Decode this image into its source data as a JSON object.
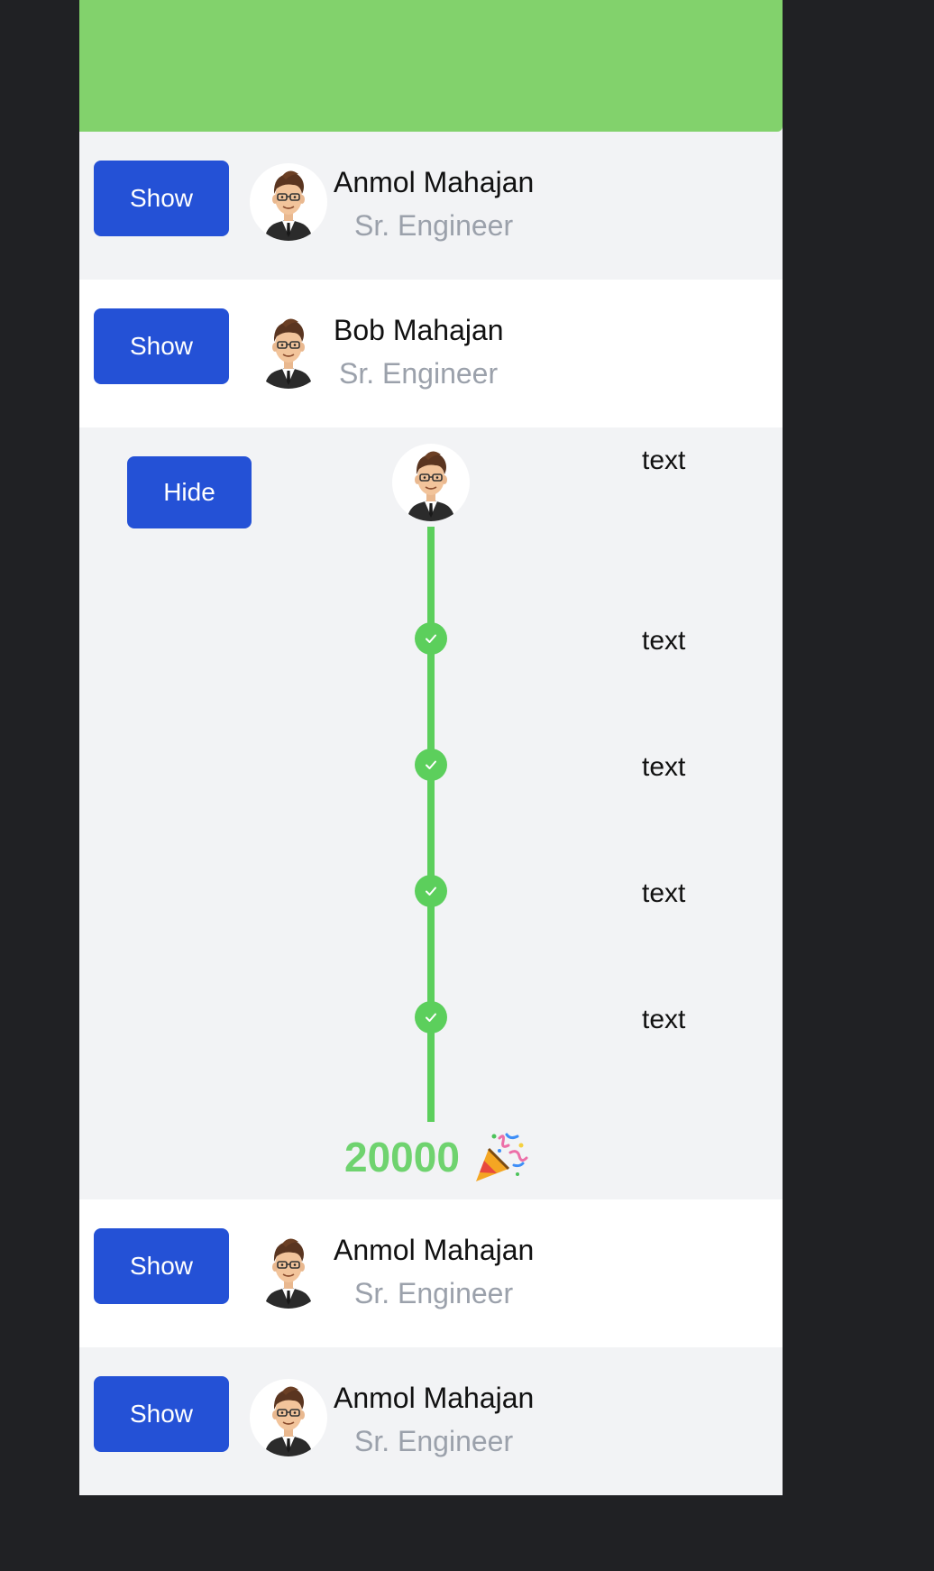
{
  "header": {
    "color": "#82d26c"
  },
  "accent": "#2451d6",
  "timeline_color": "#5ccf5c",
  "rows_top": [
    {
      "button": "Show",
      "name": "Anmol Mahajan",
      "role": "Sr. Engineer"
    },
    {
      "button": "Show",
      "name": "Bob Mahajan",
      "role": "Sr. Engineer"
    }
  ],
  "expanded": {
    "button": "Hide",
    "first_text": "text",
    "steps": [
      {
        "text": "text",
        "icon": "check-icon"
      },
      {
        "text": "text",
        "icon": "check-icon"
      },
      {
        "text": "text",
        "icon": "check-icon"
      },
      {
        "text": "text",
        "icon": "check-icon"
      }
    ],
    "total": "20000",
    "total_icon": "party-popper-icon"
  },
  "rows_bottom": [
    {
      "button": "Show",
      "name": "Anmol Mahajan",
      "role": "Sr. Engineer"
    },
    {
      "button": "Show",
      "name": "Anmol Mahajan",
      "role": "Sr. Engineer"
    }
  ]
}
